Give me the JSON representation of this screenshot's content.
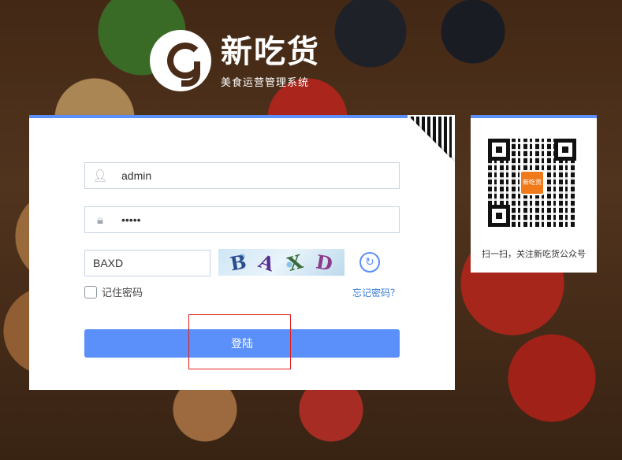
{
  "brand": {
    "title": "新吃货",
    "subtitle": "美食运营管理系统"
  },
  "login": {
    "username_value": "admin",
    "password_value": "•••••",
    "captcha_input_value": "BAXD",
    "captcha_chars": [
      "B",
      "A",
      "X",
      "D"
    ],
    "remember_label": "记住密码",
    "forgot_label": "忘记密码？",
    "login_label": "登陆"
  },
  "qr_panel": {
    "caption": "扫一扫，关注新吃货公众号",
    "center_logo": "新吃货"
  },
  "icons": {
    "user": "user-icon",
    "lock": "lock-icon",
    "refresh": "refresh-icon"
  },
  "colors": {
    "accent": "#5b8ff9",
    "highlight": "#e0211f",
    "link": "#3a7bd5"
  }
}
